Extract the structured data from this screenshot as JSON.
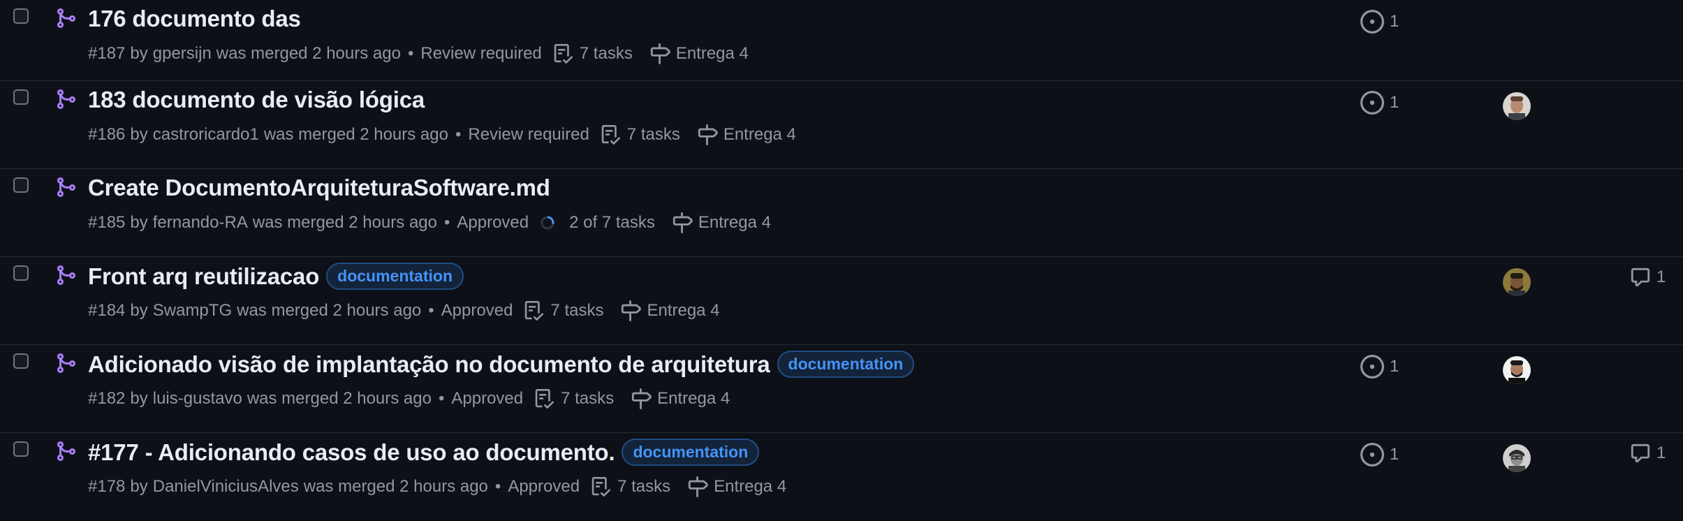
{
  "pull_requests": [
    {
      "title": "176 documento das",
      "number": "#187",
      "by": "by",
      "author": "gpersijn",
      "merged_text": "was merged 2 hours ago",
      "separator": "•",
      "review_status": "Review required",
      "tasks": "7 tasks",
      "milestone": "Entrega 4",
      "label": "",
      "linked_issues": "1",
      "comments": "",
      "has_avatar": false
    },
    {
      "title": "183 documento de visão lógica",
      "number": "#186",
      "by": "by",
      "author": "castroricardo1",
      "merged_text": "was merged 2 hours ago",
      "separator": "•",
      "review_status": "Review required",
      "tasks": "7 tasks",
      "milestone": "Entrega 4",
      "label": "",
      "linked_issues": "1",
      "comments": "",
      "has_avatar": true
    },
    {
      "title": "Create DocumentoArquiteturaSoftware.md",
      "number": "#185",
      "by": "by",
      "author": "fernando-RA",
      "merged_text": "was merged 2 hours ago",
      "separator": "•",
      "review_status": "Approved",
      "tasks": "2 of 7 tasks",
      "tasks_progress": 0.2857,
      "milestone": "Entrega 4",
      "label": "",
      "linked_issues": "",
      "comments": "",
      "has_avatar": false
    },
    {
      "title": "Front arq reutilizacao",
      "number": "#184",
      "by": "by",
      "author": "SwampTG",
      "merged_text": "was merged 2 hours ago",
      "separator": "•",
      "review_status": "Approved",
      "tasks": "7 tasks",
      "milestone": "Entrega 4",
      "label": "documentation",
      "linked_issues": "",
      "comments": "1",
      "has_avatar": true
    },
    {
      "title": "Adicionado visão de implantação no documento de arquitetura",
      "number": "#182",
      "by": "by",
      "author": "luis-gustavo",
      "merged_text": "was merged 2 hours ago",
      "separator": "•",
      "review_status": "Approved",
      "tasks": "7 tasks",
      "milestone": "Entrega 4",
      "label": "documentation",
      "linked_issues": "1",
      "comments": "",
      "has_avatar": true
    },
    {
      "title": "#177 - Adicionando casos de uso ao documento.",
      "number": "#178",
      "by": "by",
      "author": "DanielViniciusAlves",
      "merged_text": "was merged 2 hours ago",
      "separator": "•",
      "review_status": "Approved",
      "tasks": "7 tasks",
      "milestone": "Entrega 4",
      "label": "documentation",
      "linked_issues": "1",
      "comments": "1",
      "has_avatar": true
    }
  ],
  "colors": {
    "background": "#0d1117",
    "merged_purple": "#ab7df8",
    "label_blue": "#4493f8",
    "muted_text": "#9198a1",
    "title_text": "#e6edf3"
  },
  "icons": {
    "merge": "git-merge-icon",
    "tasks": "checklist-icon",
    "milestone": "milestone-icon",
    "linked_issue": "issue-opened-icon",
    "comment": "comment-icon"
  }
}
